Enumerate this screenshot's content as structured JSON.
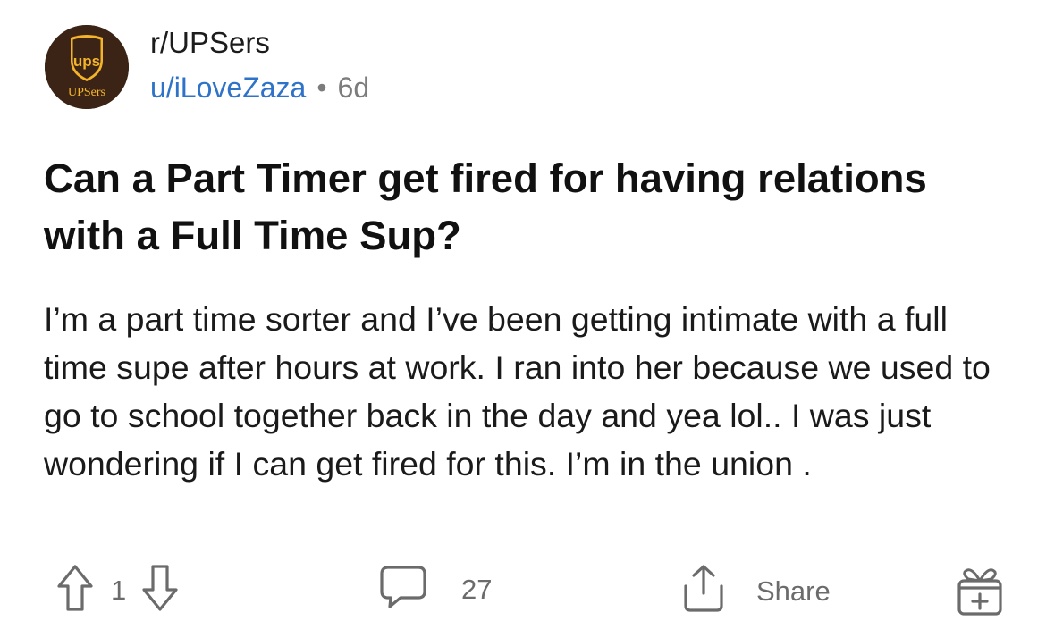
{
  "community": {
    "name": "r/UPSers",
    "avatar_text": "UPSers",
    "avatar_logo": "ups"
  },
  "author": {
    "username": "u/iLoveZaza",
    "separator": "•",
    "age": "6d"
  },
  "post": {
    "title": "Can a Part Timer get fired for having relations with a Full Time Sup?",
    "body": "I’m a part time sorter and I’ve been getting intimate with a full time supe after hours at work. I ran into her because we used to go to school together back in the day and yea lol.. I was just wondering if I can get fired for this. I’m  in the union ."
  },
  "actions": {
    "vote_count": "1",
    "comment_count": "27",
    "share_label": "Share"
  },
  "icons": {
    "upvote": "arrow-up-icon",
    "downvote": "arrow-down-icon",
    "comments": "comment-bubble-icon",
    "share": "share-upload-icon",
    "award": "gift-award-icon"
  },
  "colors": {
    "username": "#2f73c9",
    "avatar_bg": "#3b2415",
    "ups_gold": "#f4b42a",
    "icon": "#6b6b6b"
  }
}
